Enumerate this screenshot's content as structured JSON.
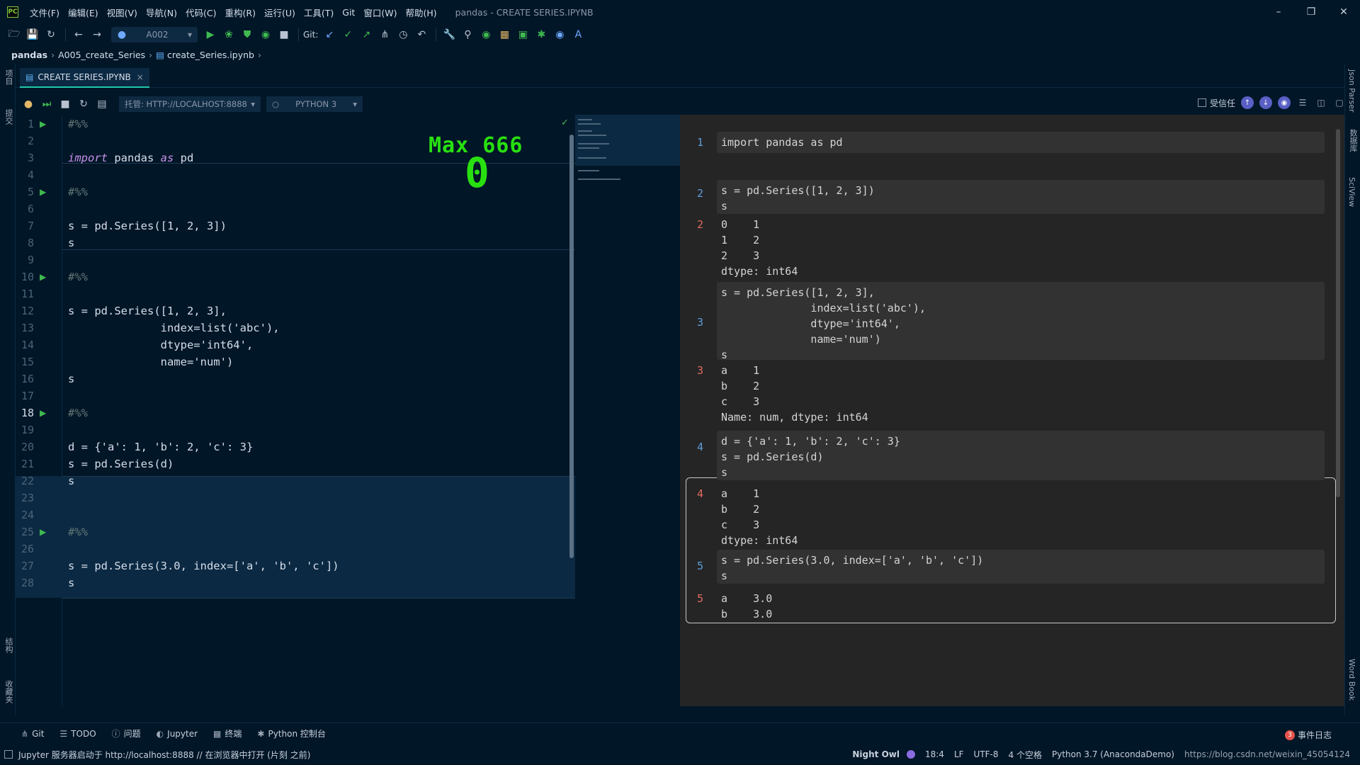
{
  "app": {
    "window_title": "pandas - CREATE SERIES.IPYNB",
    "menus": [
      "文件(F)",
      "编辑(E)",
      "视图(V)",
      "导航(N)",
      "代码(C)",
      "重构(R)",
      "运行(U)",
      "工具(T)",
      "Git",
      "窗口(W)",
      "帮助(H)"
    ]
  },
  "toolbar": {
    "run_config": "A002",
    "git_label": "Git:"
  },
  "breadcrumb": [
    "pandas",
    "A005_create_Series",
    "create_Series.ipynb"
  ],
  "tab": {
    "label": "CREATE SERIES.IPYNB"
  },
  "left_strip": {
    "top": "项目",
    "commit": "提交",
    "structure": "结构",
    "favorites": "收藏夹"
  },
  "right_strip": {
    "json": "Json Parser",
    "database": "数据库",
    "sciview": "SciView",
    "wordbook": "Word Book"
  },
  "notebook_bar": {
    "server": "托管: HTTP://LOCALHOST:8888",
    "kernel": "PYTHON 3",
    "trusted": "受信任"
  },
  "overlay": {
    "label": "Max 666",
    "value": "0"
  },
  "editor": {
    "line_numbers": [
      "1",
      "2",
      "3",
      "4",
      "5",
      "6",
      "7",
      "8",
      "9",
      "10",
      "11",
      "12",
      "13",
      "14",
      "15",
      "16",
      "17",
      "18",
      "19",
      "20",
      "21",
      "22",
      "23",
      "24",
      "25",
      "26",
      "27",
      "28"
    ],
    "current_line": "18",
    "lines": {
      "l1": "#%%",
      "l3a": "import",
      "l3b": " pandas ",
      "l3c": "as",
      "l3d": " pd",
      "l5": "#%%",
      "l7": "s = pd.Series([1, 2, 3])",
      "l8": "s",
      "l10": "#%%",
      "l12": "s = pd.Series([1, 2, 3],",
      "l13": "              index=list('abc'),",
      "l14": "              dtype='int64',",
      "l15": "              name='num')",
      "l16": "s",
      "l18": "#%%",
      "l20": "d = {'a': 1, 'b': 2, 'c': 3}",
      "l21": "s = pd.Series(d)",
      "l22": "s",
      "l24": "#%%",
      "l26": "s = pd.Series(3.0, index=['a', 'b', 'c'])",
      "l27": "s"
    }
  },
  "preview": {
    "cells": [
      {
        "n": "1",
        "input": "import pandas as pd"
      },
      {
        "n": "2",
        "input": "s = pd.Series([1, 2, 3])\ns",
        "output": "0    1\n1    2\n2    3\ndtype: int64"
      },
      {
        "n": "3",
        "input": "s = pd.Series([1, 2, 3],\n              index=list('abc'),\n              dtype='int64',\n              name='num')\ns",
        "output": "a    1\nb    2\nc    3\nName: num, dtype: int64"
      },
      {
        "n": "4",
        "input": "d = {'a': 1, 'b': 2, 'c': 3}\ns = pd.Series(d)\ns",
        "output": "a    1\nb    2\nc    3\ndtype: int64"
      },
      {
        "n": "5",
        "input": "s = pd.Series(3.0, index=['a', 'b', 'c'])\ns",
        "output": "a    3.0\nb    3.0"
      }
    ]
  },
  "bottom_tabs": [
    "Git",
    "TODO",
    "问题",
    "Jupyter",
    "终端",
    "Python 控制台"
  ],
  "event_log": {
    "count": "3",
    "label": "事件日志"
  },
  "status": {
    "message": "Jupyter 服务器启动于 http://localhost:8888 // 在浏览器中打开 (片刻 之前)",
    "theme": "Night Owl",
    "position": "18:4",
    "line_sep": "LF",
    "encoding": "UTF-8",
    "indent": "4 个空格",
    "interpreter": "Python 3.7 (AnacondaDemo)",
    "watermark": "https://blog.csdn.net/weixin_45054124"
  },
  "colors": {
    "editor_bg": "#011627",
    "preview_bg": "#252526",
    "overlay": "#28e010",
    "accent": "#21c7a8"
  }
}
